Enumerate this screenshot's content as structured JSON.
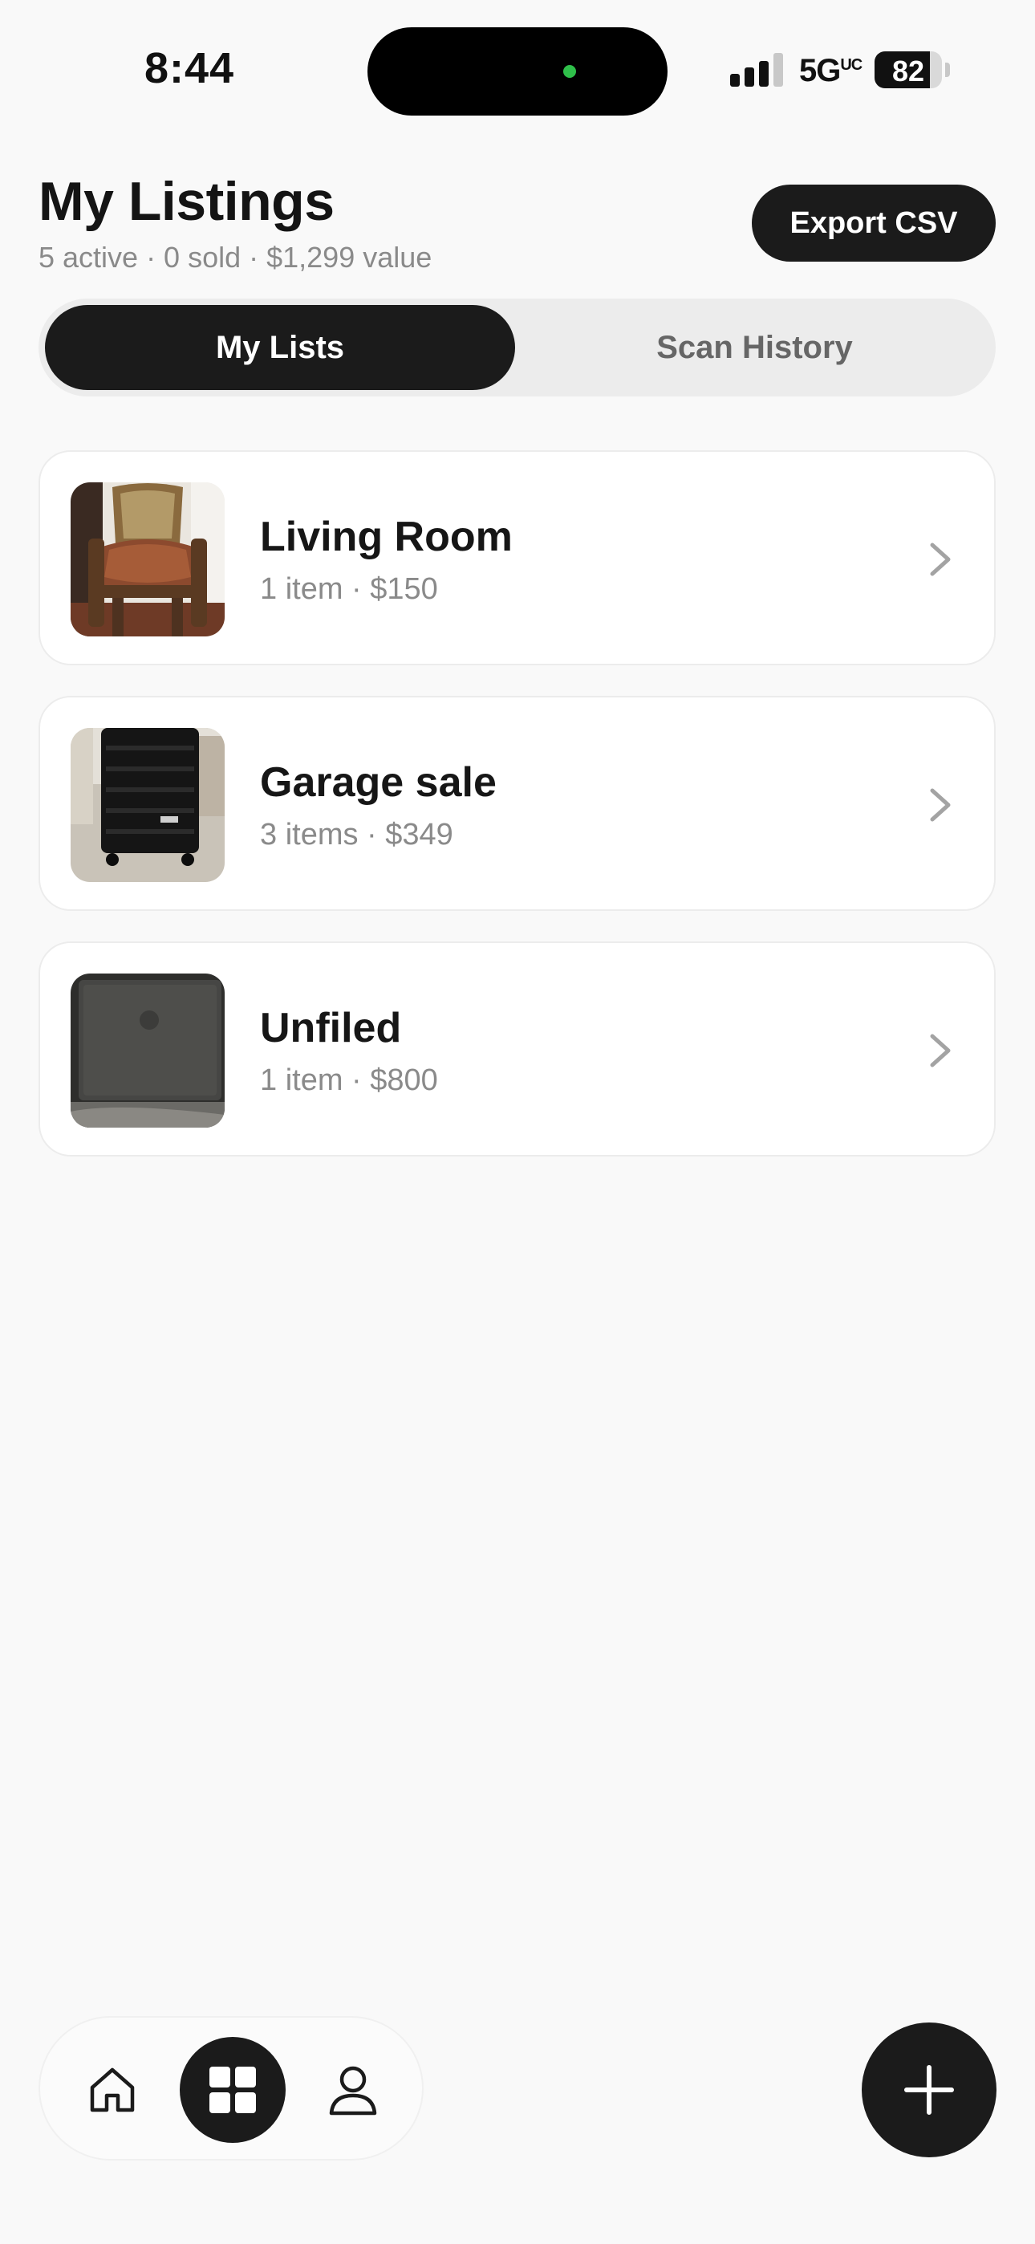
{
  "status_bar": {
    "time": "8:44",
    "network": "5G",
    "network_suffix": "UC",
    "battery": "82"
  },
  "header": {
    "title": "My Listings",
    "subtitle": "5 active · 0 sold · $1,299 value",
    "export_label": "Export CSV"
  },
  "tabs": [
    {
      "label": "My Lists",
      "active": true
    },
    {
      "label": "Scan History",
      "active": false
    }
  ],
  "lists": [
    {
      "title": "Living Room",
      "meta": "1 item · $150",
      "thumb": "armchair-photo"
    },
    {
      "title": "Garage sale",
      "meta": "3 items · $349",
      "thumb": "suitcase-photo"
    },
    {
      "title": "Unfiled",
      "meta": "1 item · $800",
      "thumb": "laptop-photo"
    }
  ],
  "bottom_nav": {
    "items": [
      {
        "icon": "home-icon",
        "active": false
      },
      {
        "icon": "grid-icon",
        "active": true
      },
      {
        "icon": "person-icon",
        "active": false
      }
    ],
    "fab_icon": "plus-icon"
  },
  "colors": {
    "background": "#f9f9f9",
    "primary_dark": "#1b1b1b",
    "muted_text": "#8a8a8a",
    "status_dot": "#2fbf4a"
  }
}
